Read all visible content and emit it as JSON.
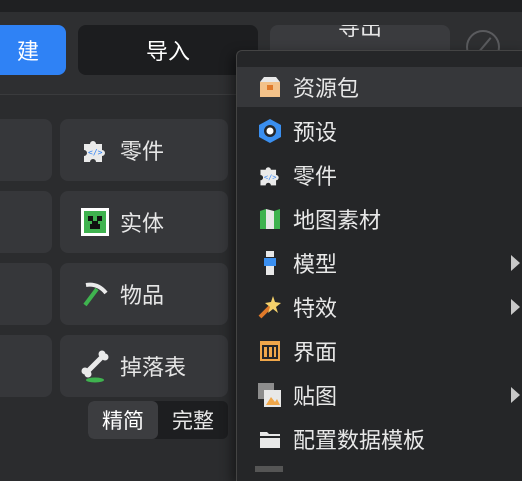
{
  "toolbar": {
    "create_label": "建",
    "import_label": "导入",
    "export_label": "导出"
  },
  "tiles": [
    {
      "label": "零件",
      "icon": "puzzle-code-icon"
    },
    {
      "label": "实体",
      "icon": "creeper-icon"
    },
    {
      "label": "物品",
      "icon": "pickaxe-icon"
    },
    {
      "label": "掉落表",
      "icon": "bone-icon"
    }
  ],
  "mode_toggle": {
    "simple": "精简",
    "full": "完整"
  },
  "menu": {
    "items": [
      {
        "label": "资源包",
        "icon": "package-icon",
        "submenu": false,
        "highlighted": true
      },
      {
        "label": "预设",
        "icon": "preset-hexagon-icon",
        "submenu": false
      },
      {
        "label": "零件",
        "icon": "puzzle-code-icon",
        "submenu": false
      },
      {
        "label": "地图素材",
        "icon": "map-icon",
        "submenu": false
      },
      {
        "label": "模型",
        "icon": "model-figure-icon",
        "submenu": true
      },
      {
        "label": "特效",
        "icon": "magic-wand-icon",
        "submenu": true
      },
      {
        "label": "界面",
        "icon": "ui-window-icon",
        "submenu": false
      },
      {
        "label": "贴图",
        "icon": "texture-image-icon",
        "submenu": true
      },
      {
        "label": "配置数据模板",
        "icon": "folder-icon",
        "submenu": false
      }
    ]
  },
  "colors": {
    "accent": "#2f82f5",
    "menu_bg": "#252628",
    "tile_bg": "#36373a"
  }
}
